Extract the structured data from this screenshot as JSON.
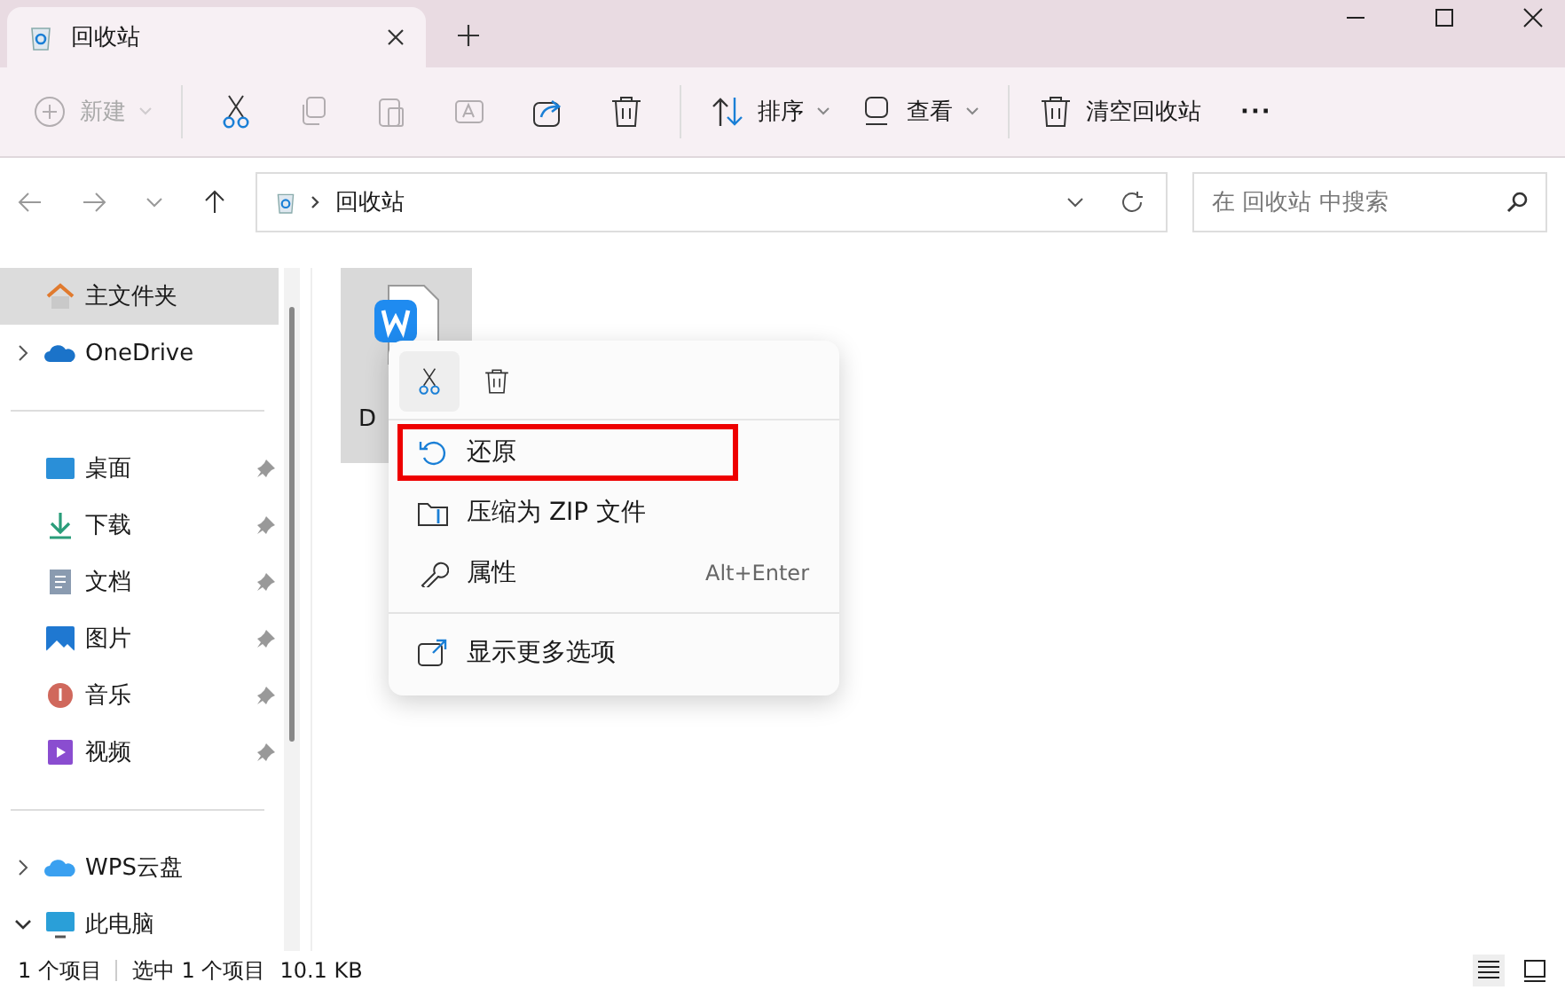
{
  "tab": {
    "title": "回收站"
  },
  "toolbar": [
    {
      "kind": "new",
      "label": "新建",
      "disabled": true
    },
    {
      "kind": "cut",
      "disabled": false
    },
    {
      "kind": "copy",
      "disabled": true
    },
    {
      "kind": "paste",
      "disabled": true
    },
    {
      "kind": "rename",
      "disabled": true
    },
    {
      "kind": "share",
      "disabled": false
    },
    {
      "kind": "delete",
      "disabled": false
    },
    {
      "kind": "sort",
      "label": "排序",
      "disabled": false
    },
    {
      "kind": "view",
      "label": "查看",
      "disabled": false
    },
    {
      "kind": "empty",
      "label": "清空回收站",
      "disabled": false
    },
    {
      "kind": "more",
      "label": "···",
      "disabled": false
    }
  ],
  "address": {
    "path": "回收站",
    "search_placeholder": "在 回收站 中搜索"
  },
  "sidebar": {
    "items": [
      {
        "kind": "home",
        "label": "主文件夹",
        "selected": true,
        "pinned": false
      },
      {
        "kind": "cloud",
        "label": "OneDrive",
        "selected": false,
        "pinned": false,
        "expanded": false
      },
      {
        "kind": "divider"
      },
      {
        "kind": "desktop",
        "label": "桌面",
        "selected": false,
        "pinned": true
      },
      {
        "kind": "download",
        "label": "下载",
        "selected": false,
        "pinned": true
      },
      {
        "kind": "docs",
        "label": "文档",
        "selected": false,
        "pinned": true
      },
      {
        "kind": "pictures",
        "label": "图片",
        "selected": false,
        "pinned": true
      },
      {
        "kind": "music",
        "label": "音乐",
        "selected": false,
        "pinned": true
      },
      {
        "kind": "video",
        "label": "视频",
        "selected": false,
        "pinned": true
      },
      {
        "kind": "divider"
      },
      {
        "kind": "wps",
        "label": "WPS云盘",
        "selected": false,
        "pinned": false,
        "expanded": false
      },
      {
        "kind": "pc",
        "label": "此电脑",
        "selected": false,
        "pinned": false,
        "expanded": true
      }
    ]
  },
  "files": [
    {
      "name": "D",
      "selected": true
    }
  ],
  "context_menu": {
    "items": [
      {
        "kind": "restore",
        "label": "还原",
        "highlighted": true
      },
      {
        "kind": "zip",
        "label": "压缩为 ZIP 文件",
        "highlighted": false
      },
      {
        "kind": "properties",
        "label": "属性",
        "shortcut": "Alt+Enter",
        "highlighted": false
      },
      {
        "kind": "divider"
      },
      {
        "kind": "more",
        "label": "显示更多选项",
        "highlighted": false
      }
    ]
  },
  "status_bar": {
    "count": "1 个项目",
    "selection": "选中 1 个项目",
    "size": "10.1 KB"
  }
}
